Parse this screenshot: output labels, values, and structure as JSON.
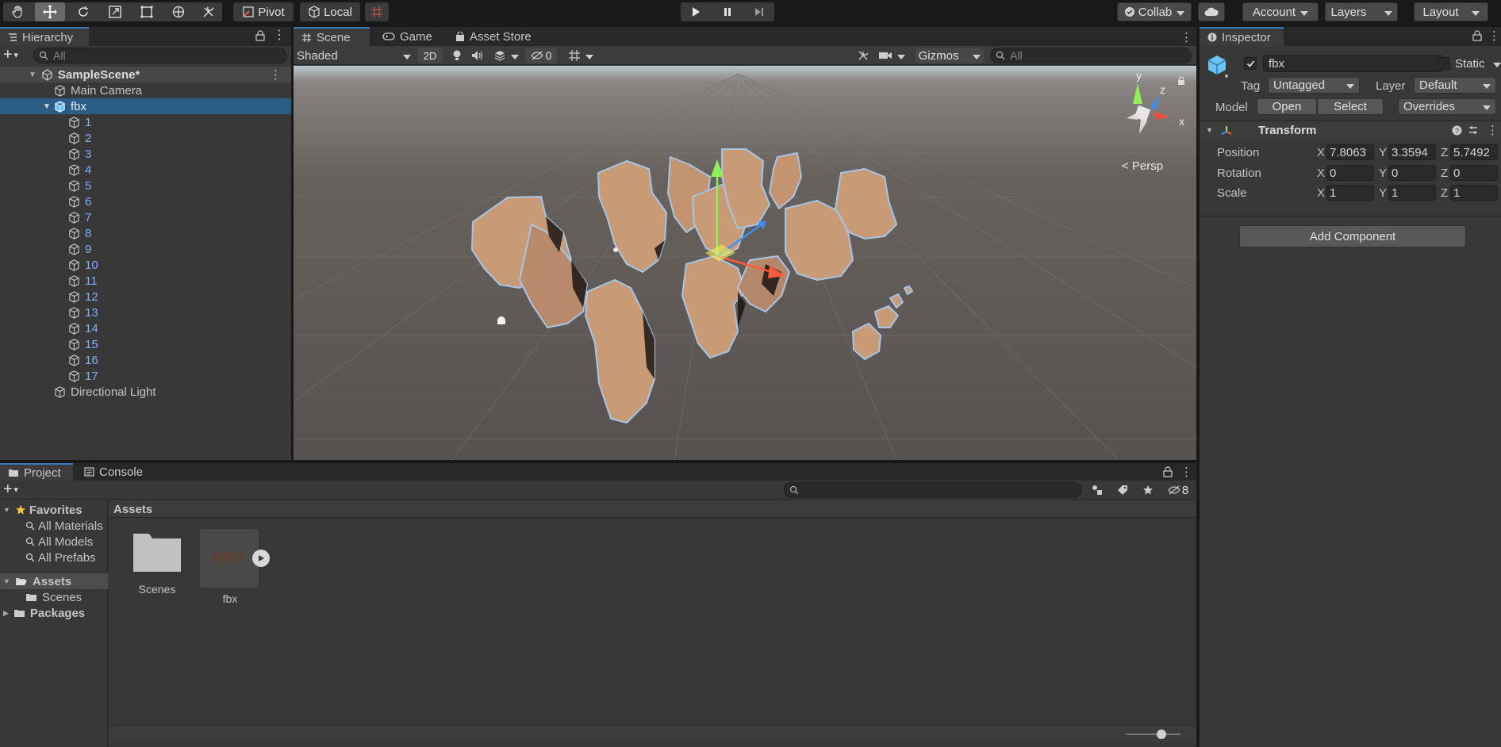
{
  "toolbar": {
    "pivot_label": "Pivot",
    "local_label": "Local",
    "collab_label": "Collab",
    "account_label": "Account",
    "layers_label": "Layers",
    "layout_label": "Layout"
  },
  "hierarchy": {
    "tab_label": "Hierarchy",
    "search_placeholder": "All",
    "scene_name": "SampleScene*",
    "items": [
      {
        "label": "Main Camera"
      },
      {
        "label": "fbx"
      },
      {
        "label": "1"
      },
      {
        "label": "2"
      },
      {
        "label": "3"
      },
      {
        "label": "4"
      },
      {
        "label": "5"
      },
      {
        "label": "6"
      },
      {
        "label": "7"
      },
      {
        "label": "8"
      },
      {
        "label": "9"
      },
      {
        "label": "10"
      },
      {
        "label": "11"
      },
      {
        "label": "12"
      },
      {
        "label": "13"
      },
      {
        "label": "14"
      },
      {
        "label": "15"
      },
      {
        "label": "16"
      },
      {
        "label": "17"
      },
      {
        "label": "Directional Light"
      }
    ]
  },
  "scene_view": {
    "tabs": [
      {
        "label": "Scene"
      },
      {
        "label": "Game"
      },
      {
        "label": "Asset Store"
      }
    ],
    "shading_mode": "Shaded",
    "mode_2d": "2D",
    "hidden_count": "0",
    "gizmos_label": "Gizmos",
    "search_placeholder": "All",
    "persp_label": "< Persp",
    "axis_y": "y",
    "axis_z": "z",
    "axis_x": "x"
  },
  "inspector": {
    "tab_label": "Inspector",
    "object_name": "fbx",
    "static_label": "Static",
    "tag_label": "Tag",
    "tag_value": "Untagged",
    "layer_label": "Layer",
    "layer_value": "Default",
    "model_label": "Model",
    "open_label": "Open",
    "select_label": "Select",
    "overrides_label": "Overrides",
    "transform_label": "Transform",
    "position_label": "Position",
    "rotation_label": "Rotation",
    "scale_label": "Scale",
    "x": "X",
    "y": "Y",
    "z": "Z",
    "position": {
      "x": "7.8063",
      "y": "3.3594",
      "z": "5.7492"
    },
    "rotation": {
      "x": "0",
      "y": "0",
      "z": "0"
    },
    "scale": {
      "x": "1",
      "y": "1",
      "z": "1"
    },
    "add_component_label": "Add Component"
  },
  "project": {
    "tabs": [
      {
        "label": "Project"
      },
      {
        "label": "Console"
      }
    ],
    "hidden_count": "8",
    "favorites_label": "Favorites",
    "favorites": [
      {
        "label": "All Materials"
      },
      {
        "label": "All Models"
      },
      {
        "label": "All Prefabs"
      }
    ],
    "assets_label": "Assets",
    "scenes_label": "Scenes",
    "packages_label": "Packages",
    "breadcrumb": "Assets",
    "items": [
      {
        "label": "Scenes"
      },
      {
        "label": "fbx"
      }
    ]
  },
  "colors": {
    "selection": "#2c5d87",
    "panel": "#383838",
    "toolbar": "#191919",
    "rock": "#c89a75"
  }
}
